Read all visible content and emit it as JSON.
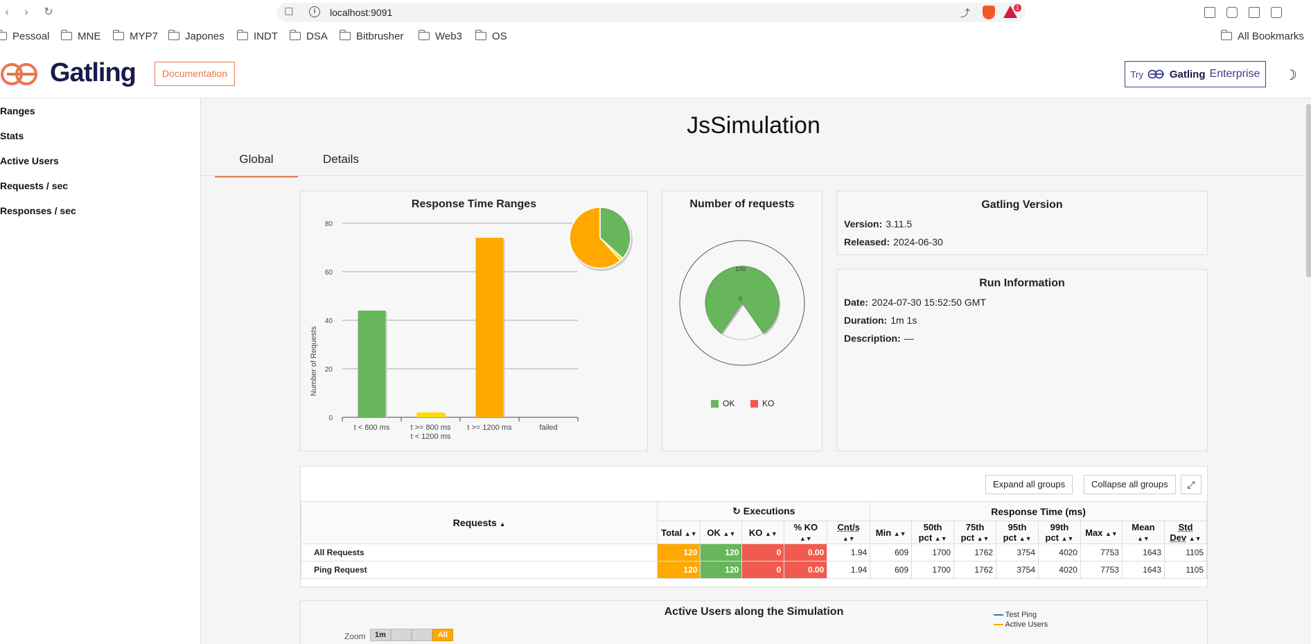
{
  "browser": {
    "url": "localhost:9091",
    "bat_badge": "1",
    "bookmarks": [
      "Pessoal",
      "MNE",
      "MYP7",
      "Japones",
      "INDT",
      "DSA",
      "Bitbrusher",
      "Web3",
      "OS"
    ],
    "all_bookmarks": "All Bookmarks"
  },
  "header": {
    "logo_text": "Gatling",
    "documentation": "Documentation",
    "enterprise_try": "Try",
    "enterprise_logo": "Gatling",
    "enterprise_word": "Enterprise"
  },
  "sidebar": {
    "items": [
      "Ranges",
      "Stats",
      "Active Users",
      "Requests / sec",
      "Responses / sec"
    ]
  },
  "main": {
    "title": "JsSimulation",
    "tabs": [
      "Global",
      "Details"
    ]
  },
  "ranges_panel": {
    "title": "Response Time Ranges",
    "ylabel": "Number of Requests",
    "yticks": [
      "80",
      "60",
      "40",
      "20",
      "0"
    ],
    "categories": [
      [
        "t < 800 ms"
      ],
      [
        "t >= 800 ms",
        "t < 1200 ms"
      ],
      [
        "t >= 1200 ms"
      ],
      [
        "failed"
      ]
    ]
  },
  "requests_panel": {
    "title": "Number of requests",
    "gauge_top": "100",
    "gauge_zero": "0",
    "legend_ok": "OK",
    "legend_ko": "KO"
  },
  "version_panel": {
    "title": "Gatling Version",
    "version_label": "Version:",
    "version": "3.11.5",
    "released_label": "Released:",
    "released": "2024-06-30"
  },
  "run_panel": {
    "title": "Run Information",
    "date_label": "Date:",
    "date": "2024-07-30 15:52:50 GMT",
    "duration_label": "Duration:",
    "duration": "1m 1s",
    "description_label": "Description:",
    "description": "—"
  },
  "table": {
    "expand": "Expand all groups",
    "collapse": "Collapse all groups",
    "requests_header": "Requests",
    "executions_header": "Executions",
    "response_header": "Response Time (ms)",
    "exec_cols": [
      "Total",
      "OK",
      "KO",
      "% KO",
      "Cnt/s"
    ],
    "rt_cols": [
      [
        "Min"
      ],
      [
        "50th",
        "pct"
      ],
      [
        "75th",
        "pct"
      ],
      [
        "95th",
        "pct"
      ],
      [
        "99th",
        "pct"
      ],
      [
        "Max"
      ],
      [
        "Mean"
      ],
      [
        "Std",
        "Dev"
      ]
    ],
    "rows": [
      {
        "name": "All Requests",
        "values": [
          "120",
          "120",
          "0",
          "0.00",
          "1.94",
          "609",
          "1700",
          "1762",
          "3754",
          "4020",
          "7753",
          "1643",
          "1105"
        ]
      },
      {
        "name": "Ping Request",
        "values": [
          "120",
          "120",
          "0",
          "0.00",
          "1.94",
          "609",
          "1700",
          "1762",
          "3754",
          "4020",
          "7753",
          "1643",
          "1105"
        ]
      }
    ]
  },
  "users_panel": {
    "title": "Active Users along the Simulation",
    "zoom_label": "Zoom",
    "zoom_1m": "1m",
    "zoom_all": "All",
    "legend": [
      "Test Ping",
      "Active Users"
    ]
  },
  "chart_data": [
    {
      "type": "bar",
      "title": "Response Time Ranges",
      "ylabel": "Number of Requests",
      "categories": [
        "t < 800 ms",
        "t >= 800 ms t < 1200 ms",
        "t >= 1200 ms",
        "failed"
      ],
      "values": [
        44,
        2,
        74,
        0
      ],
      "colors": [
        "#68b65c",
        "#ffdd00",
        "#ffa900",
        "#f15b4f"
      ],
      "ylim": [
        0,
        80
      ],
      "grid": true
    },
    {
      "type": "pie",
      "title": "Response Time Ranges",
      "categories": [
        "t < 800 ms",
        "t >= 800 ms t < 1200 ms",
        "t >= 1200 ms",
        "failed"
      ],
      "values": [
        44,
        2,
        74,
        0
      ],
      "colors": [
        "#68b65c",
        "#ffdd00",
        "#ffa900",
        "#f15b4f"
      ]
    },
    {
      "type": "pie",
      "title": "Number of requests",
      "categories": [
        "OK",
        "KO"
      ],
      "values": [
        120,
        0
      ],
      "colors": [
        "#68b65c",
        "#f15b4f"
      ]
    }
  ]
}
